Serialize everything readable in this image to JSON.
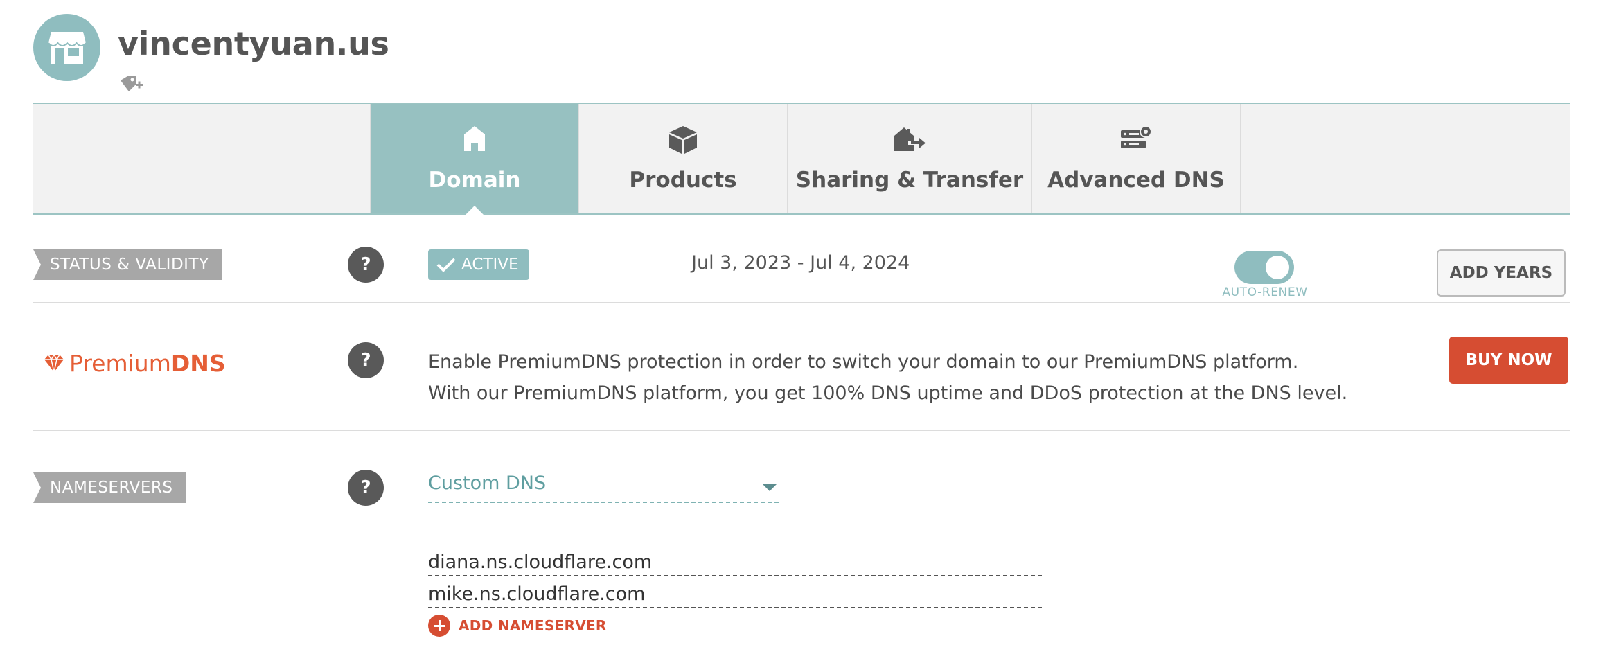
{
  "header": {
    "domain_name": "vincentyuan.us",
    "avatar_icon": "storefront-icon",
    "tag_icon": "add-tag-icon"
  },
  "tabs": [
    {
      "label": "Domain",
      "icon": "home-icon",
      "active": true
    },
    {
      "label": "Products",
      "icon": "box-icon",
      "active": false
    },
    {
      "label": "Sharing & Transfer",
      "icon": "house-transfer-icon",
      "active": false
    },
    {
      "label": "Advanced DNS",
      "icon": "server-settings-icon",
      "active": false
    }
  ],
  "status": {
    "label": "STATUS & VALIDITY",
    "badge": "ACTIVE",
    "dates": "Jul 3, 2023 - Jul 4, 2024",
    "auto_renew_label": "AUTO-RENEW",
    "auto_renew_on": true,
    "add_years_label": "ADD YEARS"
  },
  "premium_dns": {
    "logo_part1": "Premium",
    "logo_part2": "DNS",
    "line1": "Enable PremiumDNS protection in order to switch your domain to our PremiumDNS platform.",
    "line2": "With our PremiumDNS platform, you get 100% DNS uptime and DDoS protection at the DNS level.",
    "buy_label": "BUY NOW"
  },
  "nameservers": {
    "label": "NAMESERVERS",
    "selected": "Custom DNS",
    "entries": [
      "diana.ns.cloudflare.com",
      "mike.ns.cloudflare.com"
    ],
    "add_label": "ADD NAMESERVER"
  },
  "help_label": "?",
  "colors": {
    "accent_teal": "#97c1c1",
    "premium_orange": "#e55e36",
    "button_red": "#d64d32",
    "label_gray": "#a7a7a7"
  }
}
